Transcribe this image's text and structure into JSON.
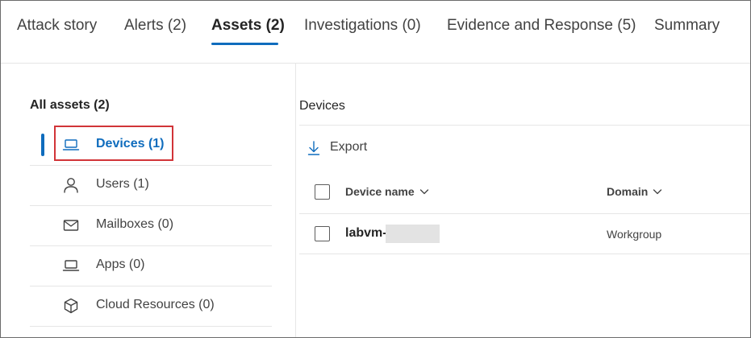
{
  "tabs": [
    {
      "label": "Attack story",
      "active": false
    },
    {
      "label": "Alerts (2)",
      "active": false
    },
    {
      "label": "Assets (2)",
      "active": true
    },
    {
      "label": "Investigations (0)",
      "active": false
    },
    {
      "label": "Evidence and Response (5)",
      "active": false
    },
    {
      "label": "Summary",
      "active": false
    }
  ],
  "sidebar": {
    "heading": "All assets (2)",
    "items": [
      {
        "label": "Devices (1)",
        "icon": "laptop-icon",
        "selected": true
      },
      {
        "label": "Users (1)",
        "icon": "user-icon",
        "selected": false
      },
      {
        "label": "Mailboxes (0)",
        "icon": "mail-icon",
        "selected": false
      },
      {
        "label": "Apps (0)",
        "icon": "laptop-icon",
        "selected": false
      },
      {
        "label": "Cloud Resources (0)",
        "icon": "cube-icon",
        "selected": false
      }
    ]
  },
  "main": {
    "title": "Devices",
    "export_label": "Export",
    "table": {
      "columns": [
        {
          "label": "Device name",
          "sortable": true
        },
        {
          "label": "Domain",
          "sortable": true
        }
      ],
      "rows": [
        {
          "device_name": "labvm-",
          "device_name_redacted": true,
          "domain": "Workgroup"
        }
      ]
    }
  },
  "colors": {
    "accent": "#0f6cbd",
    "highlight_border": "#d13438",
    "divider": "#e6e6e6",
    "redaction": "#e3e3e3"
  }
}
